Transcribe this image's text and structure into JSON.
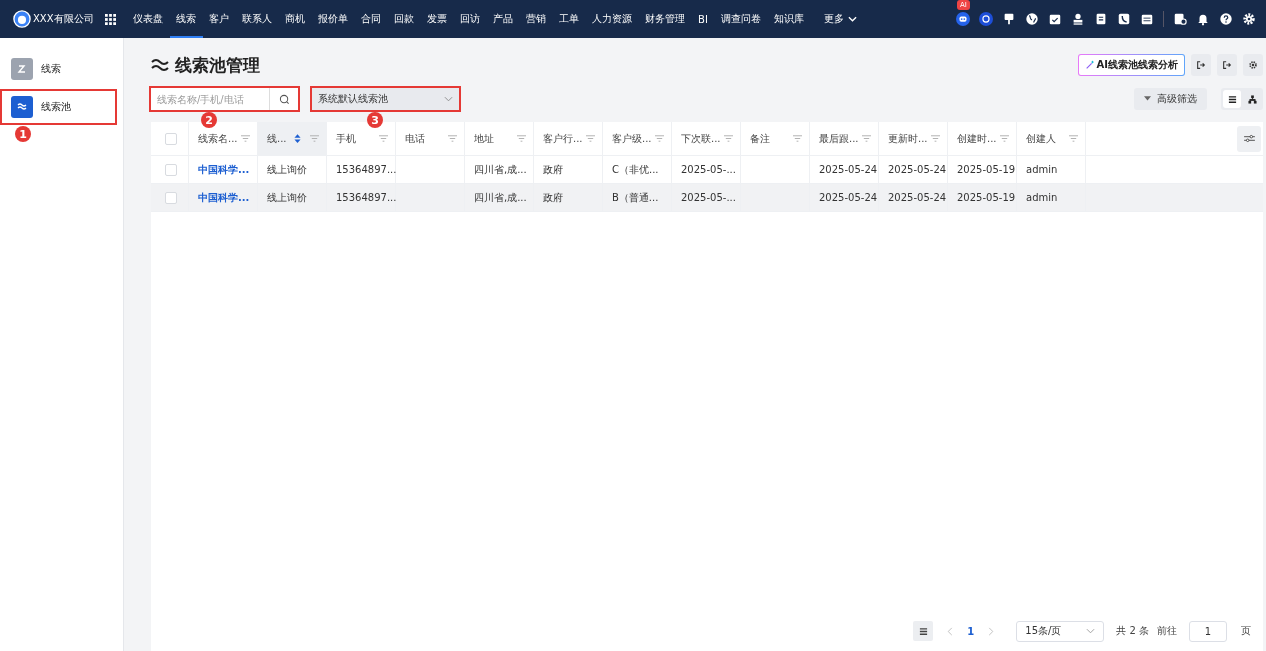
{
  "topbar": {
    "company": "XXX有限公司",
    "nav": [
      {
        "label": "仪表盘",
        "selected": false
      },
      {
        "label": "线索",
        "selected": true
      },
      {
        "label": "客户",
        "selected": false
      },
      {
        "label": "联系人",
        "selected": false
      },
      {
        "label": "商机",
        "selected": false
      },
      {
        "label": "报价单",
        "selected": false
      },
      {
        "label": "合同",
        "selected": false
      },
      {
        "label": "回款",
        "selected": false
      },
      {
        "label": "发票",
        "selected": false
      },
      {
        "label": "回访",
        "selected": false
      },
      {
        "label": "产品",
        "selected": false
      },
      {
        "label": "营销",
        "selected": false
      },
      {
        "label": "工单",
        "selected": false
      },
      {
        "label": "人力资源",
        "selected": false
      },
      {
        "label": "财务管理",
        "selected": false
      },
      {
        "label": "BI",
        "selected": false
      },
      {
        "label": "调查问卷",
        "selected": false
      },
      {
        "label": "知识库",
        "selected": false
      }
    ],
    "more": "更多",
    "ai_badge": "AI"
  },
  "sidebar": {
    "items": [
      {
        "label": "线索",
        "selected": false
      },
      {
        "label": "线索池",
        "selected": true,
        "callout": "1"
      }
    ]
  },
  "page": {
    "title": "线索池管理",
    "ai_button": "AI线索池线索分析",
    "search": {
      "placeholder": "线索名称/手机/电话",
      "callout": "2"
    },
    "pool_select": {
      "value": "系统默认线索池",
      "callout": "3"
    },
    "filter_button": "高级筛选"
  },
  "table": {
    "select_all_checked": false,
    "columns": [
      {
        "label": "线索名...",
        "sorted": false
      },
      {
        "label": "线...",
        "sorted": true
      },
      {
        "label": "手机",
        "sorted": false
      },
      {
        "label": "电话",
        "sorted": false
      },
      {
        "label": "地址",
        "sorted": false
      },
      {
        "label": "客户行...",
        "sorted": false
      },
      {
        "label": "客户级...",
        "sorted": false
      },
      {
        "label": "下次联...",
        "sorted": false
      },
      {
        "label": "备注",
        "sorted": false
      },
      {
        "label": "最后跟...",
        "sorted": false
      },
      {
        "label": "更新时...",
        "sorted": false
      },
      {
        "label": "创建时...",
        "sorted": false
      },
      {
        "label": "创建人",
        "sorted": false
      }
    ],
    "rows": [
      {
        "hovered": false,
        "checked": false,
        "cells": [
          "中国科学...",
          "线上询价",
          "15364897...",
          "",
          "四川省,成...",
          "政府",
          "C（非优...",
          "2025-05-...",
          "",
          "2025-05-24",
          "2025-05-24",
          "2025-05-19",
          "admin"
        ]
      },
      {
        "hovered": true,
        "checked": false,
        "cells": [
          "中国科学...",
          "线上询价",
          "15364897...",
          "",
          "四川省,成...",
          "政府",
          "B（普通...",
          "2025-05-...",
          "",
          "2025-05-24",
          "2025-05-24",
          "2025-05-19",
          "admin"
        ]
      }
    ]
  },
  "pagination": {
    "current": "1",
    "page_size": "15条/页",
    "total": "共 2 条",
    "goto_label": "前往",
    "goto_value": "1",
    "page_unit": "页"
  }
}
